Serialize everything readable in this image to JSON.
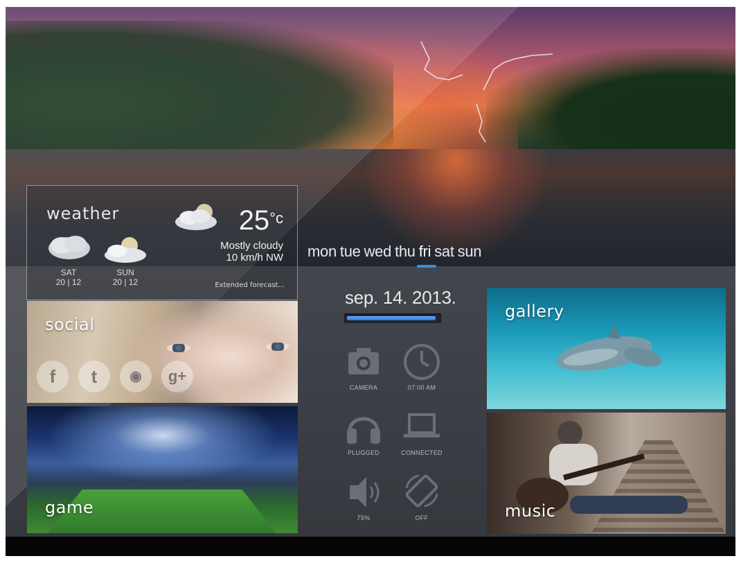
{
  "weather": {
    "title": "weather",
    "temperature": "25",
    "unit": "°c",
    "condition": "Mostly cloudy",
    "wind": "10 km/h NW",
    "extended_link": "Extended forecast...",
    "forecast": [
      {
        "day": "SAT",
        "date": "20 | 12"
      },
      {
        "day": "SUN",
        "date": "20 | 12"
      }
    ]
  },
  "days": {
    "items": [
      "mon",
      "tue",
      "wed",
      "thu",
      "fri",
      "sat",
      "sun"
    ],
    "selected": "fri"
  },
  "date": {
    "text": "sep. 14. 2013.",
    "progress": 0.97
  },
  "tiles": {
    "social": "social",
    "game": "game",
    "gallery": "gallery",
    "music": "music"
  },
  "social_icons": [
    "facebook-icon",
    "twitter-icon",
    "rss-icon",
    "google-plus-icon"
  ],
  "status": {
    "camera": "CAMERA",
    "clock": "07:00 AM",
    "headphones": "PLUGGED",
    "laptop": "CONNECTED",
    "volume": "75%",
    "rotation": "OFF"
  },
  "colors": {
    "accent": "#3a8ee0",
    "panel": "#3a3d43"
  }
}
